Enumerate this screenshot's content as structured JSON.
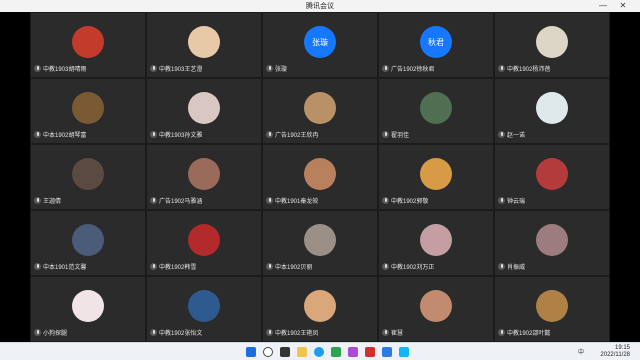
{
  "window": {
    "title": "腾讯会议",
    "minimize_label": "—",
    "close_label": "✕"
  },
  "participants": [
    {
      "name": "中教1903胡晴雨",
      "avatar": "cartoon-girl-avatar",
      "color": "#c33b2b"
    },
    {
      "name": "中教1903王艺澄",
      "avatar": "cartoon-bear-avatar",
      "color": "#e7c9a8"
    },
    {
      "name": "张璇",
      "avatar_text": "张璇",
      "color": "#1677ff"
    },
    {
      "name": "广告1902徐秋君",
      "avatar_text": "秋君",
      "color": "#1677ff"
    },
    {
      "name": "中教1902杨沛蓓",
      "avatar": "cartoon-face-avatar",
      "color": "#ddd6c6"
    },
    {
      "name": "中本1902胡琴富",
      "avatar": "dog-photo-avatar",
      "color": "#7a5a35"
    },
    {
      "name": "中教1903孙文雅",
      "avatar": "blank-avatar",
      "color": "#d8c7c2"
    },
    {
      "name": "广告1902王欣冉",
      "avatar": "doll-avatar",
      "color": "#b89166"
    },
    {
      "name": "翟羽佳",
      "avatar": "landscape-avatar",
      "color": "#4f6e52"
    },
    {
      "name": "赵一诺",
      "avatar": "music-note-avatar",
      "color": "#dfe9ea"
    },
    {
      "name": "王迦倩",
      "avatar": "girl-photo-avatar",
      "color": "#5b4a40"
    },
    {
      "name": "广告1902马雅涵",
      "avatar": "girl-photo-avatar",
      "color": "#9a6a5a"
    },
    {
      "name": "中教1901秦龙皎",
      "avatar": "girl-photo-avatar",
      "color": "#b9805e"
    },
    {
      "name": "中教1902郭敬",
      "avatar": "girl-photo-avatar",
      "color": "#d79a45"
    },
    {
      "name": "钟云瑞",
      "avatar": "room-photo-avatar",
      "color": "#b33b3b"
    },
    {
      "name": "中本1901范文馨",
      "avatar": "girl-photo-avatar",
      "color": "#4a5c7a"
    },
    {
      "name": "中教1902韩雪",
      "avatar": "girl-photo-avatar",
      "color": "#b22a2a"
    },
    {
      "name": "中本1902贝丽",
      "avatar": "girl-photo-avatar",
      "color": "#9b8f86"
    },
    {
      "name": "中教1902刘万正",
      "avatar": "girl-photo-avatar",
      "color": "#c49ea3"
    },
    {
      "name": "肖振威",
      "avatar": "girl-photo-avatar",
      "color": "#9c7c7e"
    },
    {
      "name": "小狗探腿",
      "avatar": "cartoon-pig-avatar",
      "color": "#f1e4e6"
    },
    {
      "name": "中教1902张怡文",
      "avatar": "boy-photo-avatar",
      "color": "#2e5a8f"
    },
    {
      "name": "中教1902王艳凤",
      "avatar": "baby-photo-avatar",
      "color": "#d9a77a"
    },
    {
      "name": "崔慧",
      "avatar": "cartoon-girl-avatar",
      "color": "#c28a6e"
    },
    {
      "name": "中教1902邵叶懿",
      "avatar": "dog-photo-avatar",
      "color": "#b08145"
    }
  ],
  "taskbar": {
    "apps": [
      "windows-icon",
      "search-icon",
      "task-view-icon",
      "explorer-icon",
      "browser-icon",
      "chat-icon",
      "store-icon",
      "wps-icon",
      "mail-icon",
      "meeting-icon"
    ],
    "tray": [
      "中"
    ],
    "time": "19:15",
    "date": "2022/11/28"
  }
}
